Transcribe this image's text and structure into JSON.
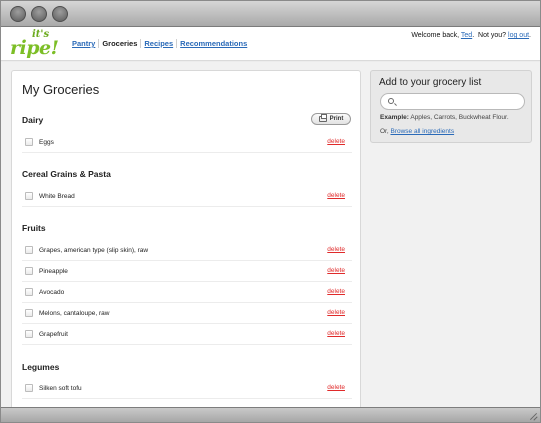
{
  "logo": {
    "top": "it's",
    "main": "ripe!"
  },
  "nav": {
    "pantry": "Pantry",
    "groceries": "Groceries",
    "recipes": "Recipes",
    "recommendations": "Recommendations"
  },
  "welcome": {
    "prefix": "Welcome back,",
    "user": "Ted",
    "period": ".",
    "not_you": "Not you?",
    "logout": "log out",
    "end": "."
  },
  "main": {
    "title": "My Groceries",
    "print_label": "Print",
    "delete_label": "delete",
    "sections": {
      "dairy": {
        "title": "Dairy",
        "items": [
          "Eggs"
        ]
      },
      "cereal": {
        "title": "Cereal Grains & Pasta",
        "items": [
          "White Bread"
        ]
      },
      "fruits": {
        "title": "Fruits",
        "items": [
          "Grapes, american type (slip skin), raw",
          "Pineapple",
          "Avocado",
          "Melons, cantaloupe, raw",
          "Grapefruit"
        ]
      },
      "legumes": {
        "title": "Legumes",
        "items": [
          "Silken soft tofu"
        ]
      }
    }
  },
  "sidebar": {
    "title": "Add to your grocery list",
    "search_placeholder": "",
    "example_label": "Example:",
    "example_text": "Apples, Carrots, Buckwheat Flour.",
    "or_text": "Or,",
    "browse_link": "Browse all ingredients"
  }
}
